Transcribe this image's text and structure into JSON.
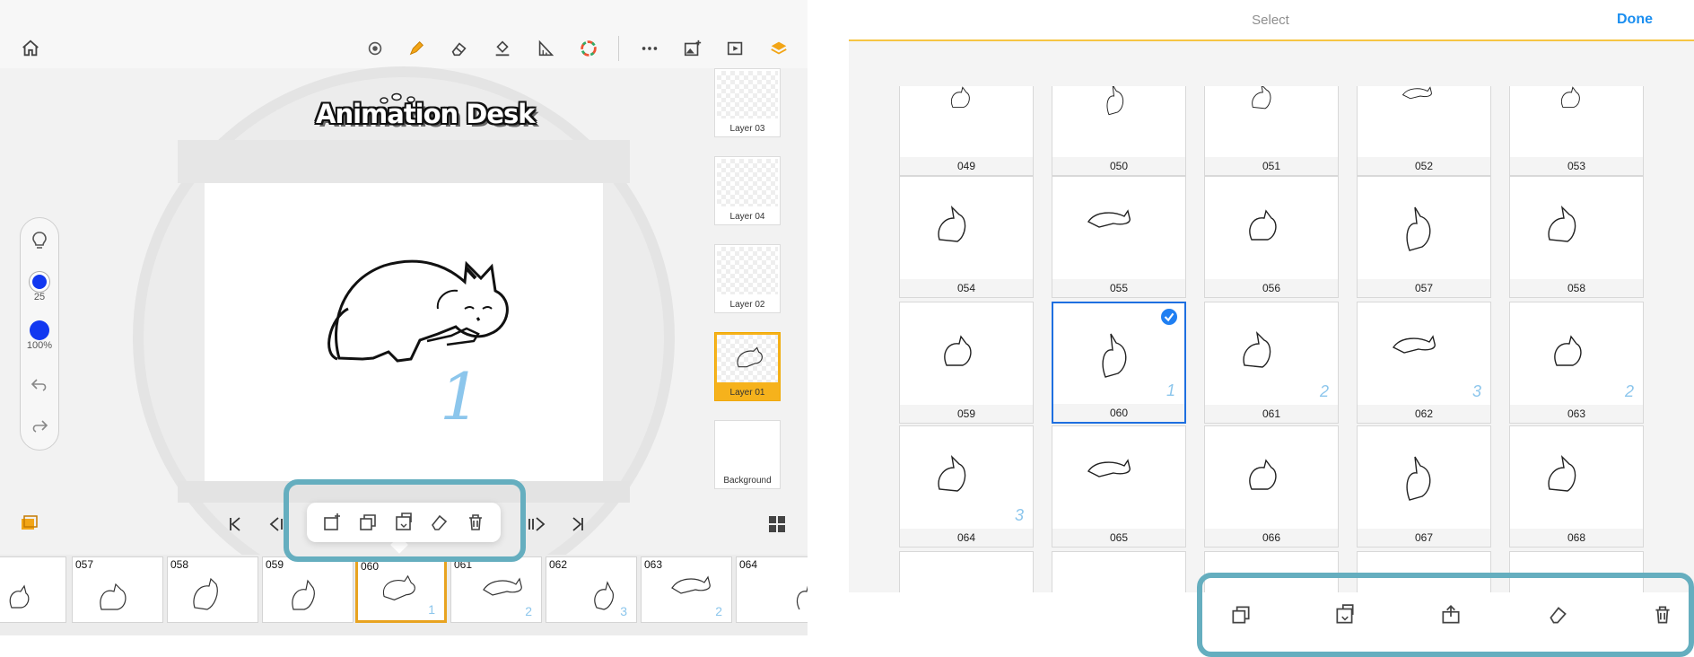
{
  "left_app": {
    "logo_text": "Animation Desk",
    "canvas_frame_mark": "1",
    "tools": {
      "brush_size": "25",
      "opacity": "100%"
    },
    "layers": [
      {
        "label": "Layer 03",
        "active": false
      },
      {
        "label": "Layer 04",
        "active": false
      },
      {
        "label": "Layer 02",
        "active": false
      },
      {
        "label": "Layer 01",
        "active": true
      },
      {
        "label": "Background",
        "active": false
      }
    ],
    "filmstrip": [
      {
        "num": "",
        "mark": ""
      },
      {
        "num": "057",
        "mark": ""
      },
      {
        "num": "058",
        "mark": ""
      },
      {
        "num": "059",
        "mark": ""
      },
      {
        "num": "060",
        "mark": "1",
        "active": true
      },
      {
        "num": "061",
        "mark": "2"
      },
      {
        "num": "062",
        "mark": "3"
      },
      {
        "num": "063",
        "mark": "2"
      },
      {
        "num": "064",
        "mark": ""
      }
    ],
    "colors": {
      "accent": "#f6b21c",
      "brush": "#1238f0",
      "highlight": "#65aebf"
    }
  },
  "right_app": {
    "title": "Select",
    "done_label": "Done",
    "rows": [
      [
        "049",
        "050",
        "051",
        "052",
        "053"
      ],
      [
        "054",
        "055",
        "056",
        "057",
        "058"
      ],
      [
        "059",
        "060",
        "061",
        "062",
        "063"
      ],
      [
        "064",
        "065",
        "066",
        "067",
        "068"
      ]
    ],
    "selected_frame": "060",
    "marks": {
      "060": "1",
      "061": "2",
      "062": "3",
      "063": "2",
      "064": "3"
    },
    "colors": {
      "accent_line": "#f6c543",
      "done": "#1a8ef0",
      "selection": "#1e6fe0"
    }
  }
}
